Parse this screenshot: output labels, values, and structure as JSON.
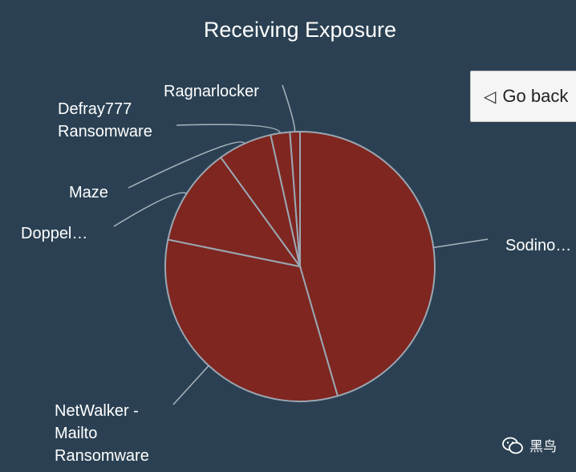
{
  "chart_data": {
    "type": "pie",
    "title": "Receiving Exposure",
    "slices": [
      {
        "label": "Sodino…",
        "value": 45.5
      },
      {
        "label": "NetWalker - Mailto Ransomware",
        "value": 32.7
      },
      {
        "label": "Doppel…",
        "value": 11.8
      },
      {
        "label": "Maze",
        "value": 6.5
      },
      {
        "label": "Defray777 Ransomware",
        "value": 2.3
      },
      {
        "label": "Ragnarlocker",
        "value": 1.2
      }
    ],
    "slice_color": "#7f2620",
    "border_color": "#9aa7b2",
    "leader_color": "#a8b4bd",
    "label_color": "#ffffff",
    "background": "#2b4153"
  },
  "ui": {
    "go_back_label": "Go back",
    "go_back_icon": "◁"
  },
  "watermark": {
    "text": "黑鸟",
    "icon": "wechat-icon"
  }
}
